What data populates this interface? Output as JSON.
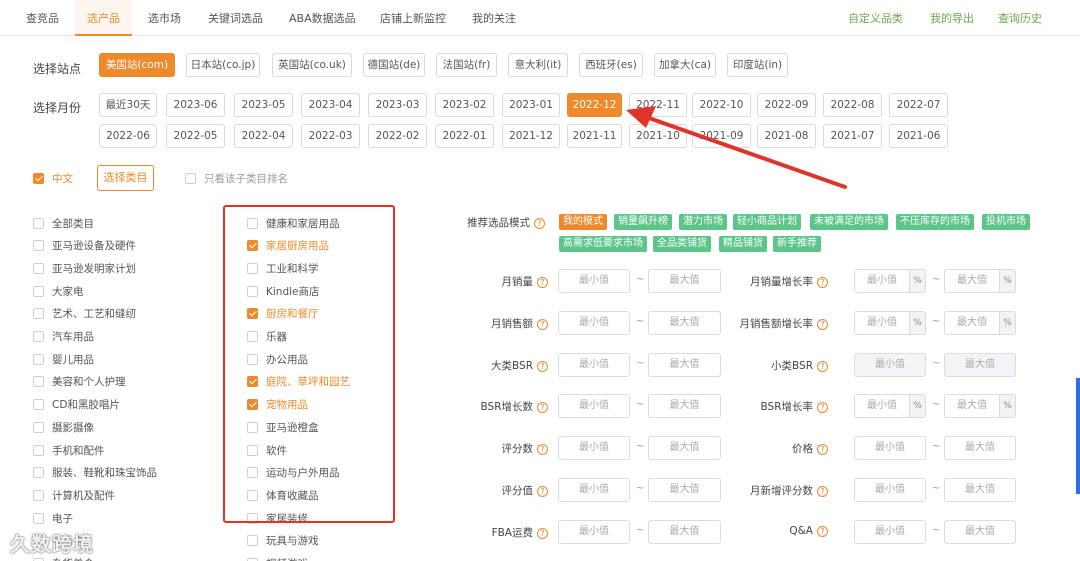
{
  "top_tabs": [
    "查竞品",
    "选产品",
    "选市场",
    "关键词选品",
    "ABA数据选品",
    "店铺上新监控",
    "我的关注"
  ],
  "right_links": [
    "自定义品类",
    "我的导出",
    "查询历史"
  ],
  "site_label": "选择站点",
  "sites": [
    "美国站(com)",
    "日本站(co.jp)",
    "英国站(co.uk)",
    "德国站(de)",
    "法国站(fr)",
    "意大利(it)",
    "西班牙(es)",
    "加拿大(ca)",
    "印度站(in)"
  ],
  "active_site": "美国站(com)",
  "month_label": "选择月份",
  "months_row1": [
    "最近30天",
    "2023-06",
    "2023-05",
    "2023-04",
    "2023-03",
    "2023-02",
    "2023-01",
    "2022-12",
    "2022-11",
    "2022-10",
    "2022-09",
    "2022-08",
    "2022-07"
  ],
  "months_row2": [
    "2022-06",
    "2022-05",
    "2022-04",
    "2022-03",
    "2022-02",
    "2022-01",
    "2021-12",
    "2021-11",
    "2021-10",
    "2021-09",
    "2021-08",
    "2021-07",
    "2021-06"
  ],
  "active_month": "2022-12",
  "lang_label": "中文",
  "select_category_button": "选择类目",
  "only_subcategory_label": "只看该子类目排名",
  "categories_left": [
    "全部类目",
    "亚马逊设备及硬件",
    "亚马逊发明家计划",
    "大家电",
    "艺术、工艺和缝纫",
    "汽车用品",
    "婴儿用品",
    "美容和个人护理",
    "CD和黑胶唱片",
    "摄影摄像",
    "手机和配件",
    "服装、鞋靴和珠宝饰品",
    "计算机及配件",
    "电子",
    "礼品卡",
    "杂货美食"
  ],
  "categories_right": [
    {
      "label": "健康和家居用品",
      "checked": false
    },
    {
      "label": "家居厨房用品",
      "checked": true
    },
    {
      "label": "工业和科学",
      "checked": false
    },
    {
      "label": "Kindle商店",
      "checked": false
    },
    {
      "label": "厨房和餐厅",
      "checked": true
    },
    {
      "label": "乐器",
      "checked": false
    },
    {
      "label": "办公用品",
      "checked": false
    },
    {
      "label": "庭院、草坪和园艺",
      "checked": true
    },
    {
      "label": "宠物用品",
      "checked": true
    },
    {
      "label": "亚马逊橙盒",
      "checked": false
    },
    {
      "label": "软件",
      "checked": false
    },
    {
      "label": "运动与户外用品",
      "checked": false
    },
    {
      "label": "体育收藏品",
      "checked": false
    },
    {
      "label": "家居装修",
      "checked": false
    },
    {
      "label": "玩具与游戏",
      "checked": false
    },
    {
      "label": "视频游戏",
      "checked": false
    }
  ],
  "recommend_label": "推荐选品模式",
  "recommend_tags": [
    "我的模式",
    "销量飙升榜",
    "潜力市场",
    "轻小商品计划",
    "未被满足的市场",
    "不压库存的市场",
    "投机市场",
    "高需求低要求市场",
    "全品类铺货",
    "精品铺货",
    "新手推荐"
  ],
  "filters_left": [
    "月销量",
    "月销售额",
    "大类BSR",
    "BSR增长数",
    "评分数",
    "评分值",
    "FBA运费"
  ],
  "filters_right": [
    "月销量增长率",
    "月销售额增长率",
    "小类BSR",
    "BSR增长率",
    "价格",
    "月新增评分数",
    "Q&A"
  ],
  "placeholder_min": "最小值",
  "placeholder_max": "最大值",
  "percent_sign": "%",
  "tilde": "~",
  "help_glyph": "?",
  "watermark": "久数跨境",
  "colors": {
    "accent": "#ee8a2c",
    "green": "#5cc58a",
    "annotation": "#e0342a",
    "link": "#6aa84f"
  }
}
